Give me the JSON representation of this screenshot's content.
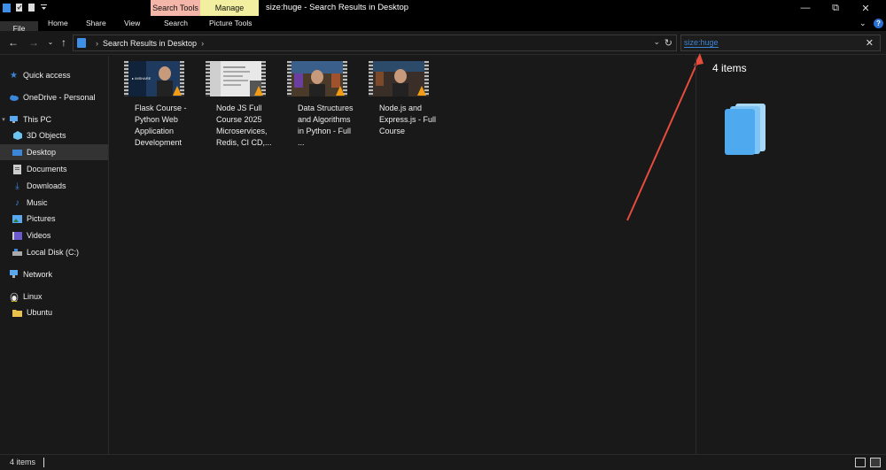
{
  "window": {
    "title": "size:huge - Search Results in Desktop",
    "context_tabs": [
      "Search Tools",
      "Manage"
    ]
  },
  "ribbon": {
    "tabs": [
      "File",
      "Home",
      "Share",
      "View",
      "Search",
      "Picture Tools"
    ]
  },
  "address": {
    "path": [
      "Search Results in Desktop"
    ]
  },
  "search": {
    "value": "size:huge"
  },
  "sidebar": {
    "items": [
      {
        "label": "Quick access",
        "icon": "star-icon"
      },
      {
        "label": "OneDrive - Personal",
        "icon": "cloud-icon"
      },
      {
        "label": "This PC",
        "icon": "pc-icon"
      },
      {
        "label": "3D Objects",
        "icon": "cube-icon"
      },
      {
        "label": "Desktop",
        "icon": "desktop-icon"
      },
      {
        "label": "Documents",
        "icon": "document-icon"
      },
      {
        "label": "Downloads",
        "icon": "download-icon"
      },
      {
        "label": "Music",
        "icon": "music-icon"
      },
      {
        "label": "Pictures",
        "icon": "pictures-icon"
      },
      {
        "label": "Videos",
        "icon": "video-icon"
      },
      {
        "label": "Local Disk (C:)",
        "icon": "drive-icon"
      },
      {
        "label": "Network",
        "icon": "network-icon"
      },
      {
        "label": "Linux",
        "icon": "linux-icon"
      },
      {
        "label": "Ubuntu",
        "icon": "folder-icon"
      }
    ],
    "selected": "Desktop"
  },
  "files": [
    {
      "name": "Flask Course - Python Web Application Development",
      "thumb_color": "#1e3a5f"
    },
    {
      "name": "Node JS Full Course 2025 Microservices, Redis, CI CD,...",
      "thumb_color": "#e8e8e8"
    },
    {
      "name": "Data Structures and Algorithms in Python - Full ...",
      "thumb_color": "#4a3a2a"
    },
    {
      "name": "Node.js and Express.js - Full Course",
      "thumb_color": "#3a2e28"
    }
  ],
  "details": {
    "count": "4 items"
  },
  "status": {
    "count": "4 items"
  },
  "colors": {
    "accent": "#3b86d8",
    "annotation_arrow": "#e74c3c",
    "search_tools_tab": "#f3b6a8",
    "manage_tab": "#f2f0a0"
  }
}
